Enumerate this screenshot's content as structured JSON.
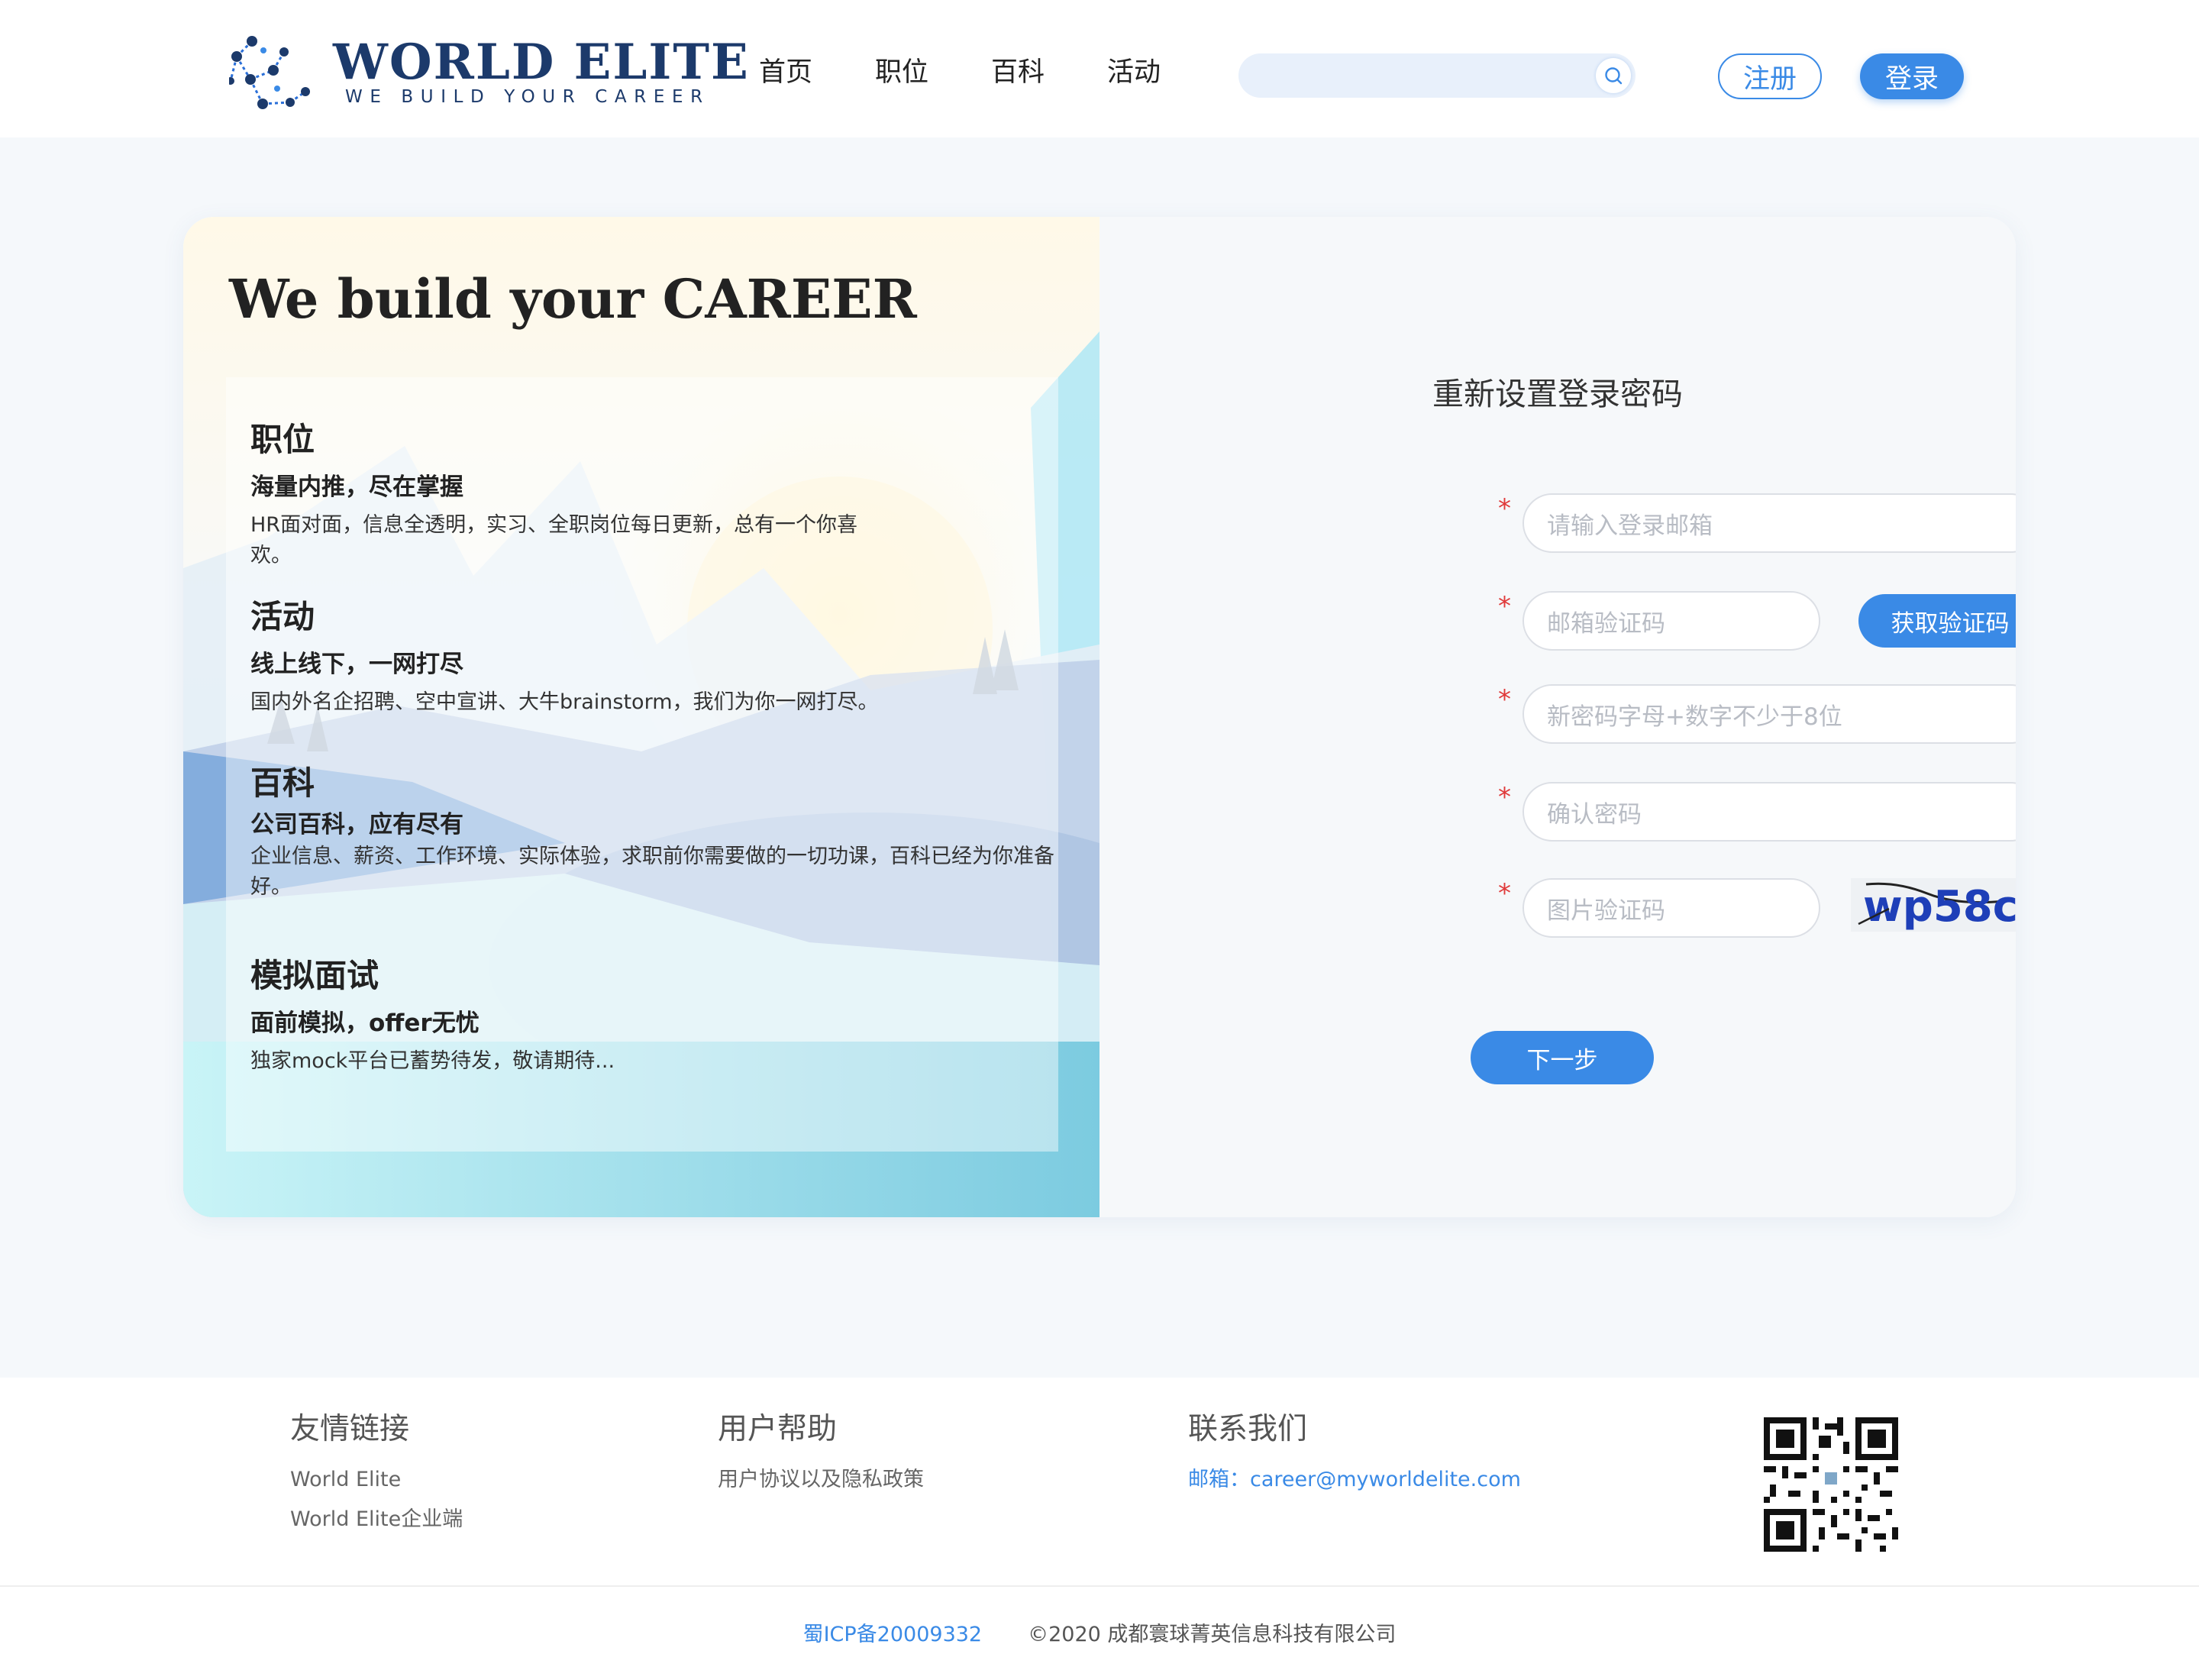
{
  "header": {
    "logo_title": "WORLD ELITE",
    "logo_subtitle": "WE BUILD YOUR CAREER",
    "nav": [
      "首页",
      "职位",
      "百科",
      "活动"
    ],
    "search_placeholder": "",
    "register": "注册",
    "login": "登录"
  },
  "hero": {
    "title": "We build your CAREER",
    "features": [
      {
        "title": "职位",
        "subtitle": "海量内推，尽在掌握",
        "desc": "HR面对面，信息全透明，实习、全职岗位每日更新，总有一个你喜欢。"
      },
      {
        "title": "活动",
        "subtitle": "线上线下，一网打尽",
        "desc": "国内外名企招聘、空中宣讲、大牛brainstorm，我们为你一网打尽。"
      },
      {
        "title": "百科",
        "subtitle": "公司百科，应有尽有",
        "desc": "企业信息、薪资、工作环境、实际体验，求职前你需要做的一切功课，百科已经为你准备好。"
      },
      {
        "title": "模拟面试",
        "subtitle": "面前模拟，offer无忧",
        "desc": "独家mock平台已蓄势待发，敬请期待..."
      }
    ]
  },
  "form": {
    "title": "重新设置登录密码",
    "required_mark": "*",
    "email_placeholder": "请输入登录邮箱",
    "email_code_placeholder": "邮箱验证码",
    "get_code": "获取验证码",
    "new_password_placeholder": "新密码字母+数字不少于8位",
    "confirm_password_placeholder": "确认密码",
    "image_code_placeholder": "图片验证码",
    "captcha_text": "wp58c",
    "next": "下一步"
  },
  "footer": {
    "links_heading": "友情链接",
    "links": [
      "World Elite",
      "World Elite企业端"
    ],
    "help_heading": "用户帮助",
    "help_links": [
      "用户协议以及隐私政策"
    ],
    "contact_heading": "联系我们",
    "email_label": "邮箱：",
    "email": "career@myworldelite.com",
    "icp": "蜀ICP备20009332",
    "copyright": "©2020 成都寰球菁英信息科技有限公司"
  },
  "colors": {
    "primary": "#3a8ae6",
    "brand_navy": "#1c3a6b",
    "highlight": "#ffd45a",
    "required": "#e03a3a"
  }
}
